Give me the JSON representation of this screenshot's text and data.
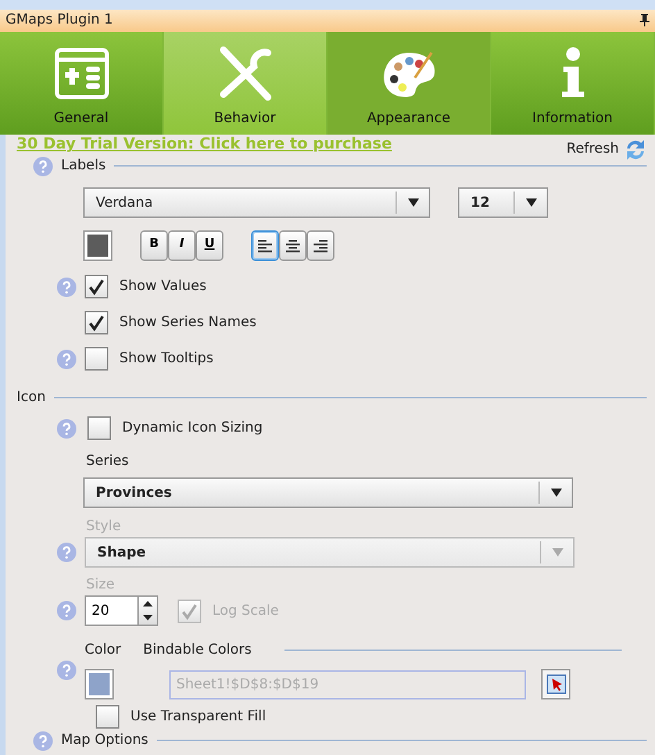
{
  "window": {
    "title": "GMaps Plugin 1"
  },
  "tabs": [
    {
      "label": "General",
      "kind": "general",
      "selected": false,
      "highlighted": false
    },
    {
      "label": "Behavior",
      "kind": "behavior",
      "selected": false,
      "highlighted": true
    },
    {
      "label": "Appearance",
      "kind": "appearance",
      "selected": true,
      "highlighted": false
    },
    {
      "label": "Information",
      "kind": "information",
      "selected": false,
      "highlighted": false
    }
  ],
  "trial_link": "30 Day Trial Version: Click here to purchase",
  "refresh": "Refresh",
  "labels_section": {
    "title": "Labels",
    "font": "Verdana",
    "font_size": "12",
    "styles": [
      {
        "label": "B",
        "kind": "bold",
        "selected": false
      },
      {
        "label": "I",
        "kind": "italic",
        "selected": false
      },
      {
        "label": "U",
        "kind": "underline",
        "selected": false
      }
    ],
    "alignment": [
      {
        "kind": "left",
        "selected": true
      },
      {
        "kind": "center",
        "selected": false
      },
      {
        "kind": "right",
        "selected": false
      }
    ],
    "options": [
      {
        "label": "Show Values",
        "checked": true,
        "help": true
      },
      {
        "label": "Show Series Names",
        "checked": true,
        "help": false
      },
      {
        "label": "Show Tooltips",
        "checked": false,
        "help": true
      }
    ]
  },
  "icon_section": {
    "title": "Icon",
    "dynamic_sizing": {
      "label": "Dynamic Icon Sizing",
      "checked": false
    },
    "series_label": "Series",
    "series": "Provinces",
    "style_label": "Style",
    "style": "Shape",
    "style_disabled": true,
    "size_label": "Size",
    "size": "20",
    "log_scale": {
      "label": "Log Scale",
      "checked": true,
      "disabled": true
    },
    "color_label": "Color",
    "bindable_label": "Bindable Colors",
    "range": "Sheet1!$D$8:$D$19",
    "transparent_fill": {
      "label": "Use Transparent Fill",
      "checked": false
    }
  },
  "map_options": {
    "title": "Map Options"
  }
}
